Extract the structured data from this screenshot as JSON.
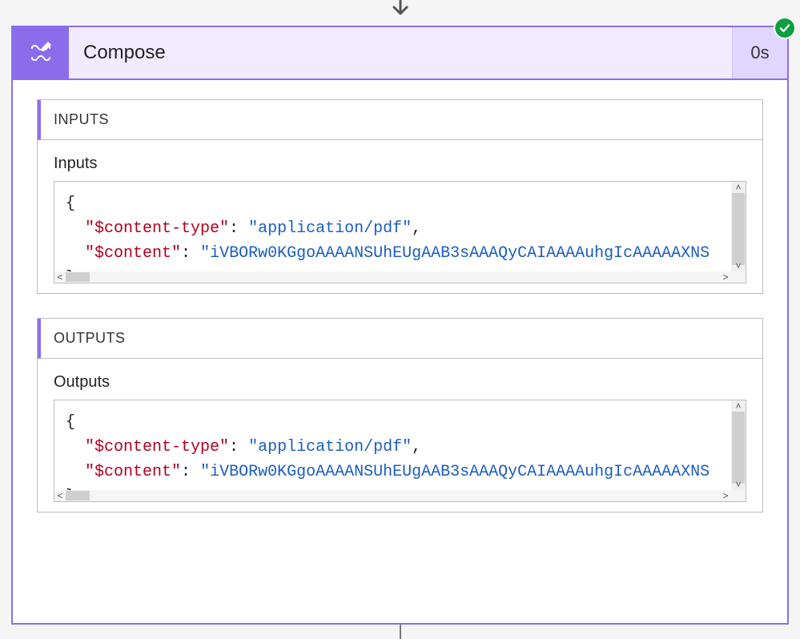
{
  "action": {
    "title": "Compose",
    "duration": "0s",
    "status": "success"
  },
  "panels": {
    "inputs": {
      "header": "INPUTS",
      "label": "Inputs",
      "json": {
        "open": "{",
        "close": "}",
        "lines": [
          {
            "key": "\"$content-type\"",
            "colon": ": ",
            "value": "\"application/pdf\"",
            "trail": ","
          },
          {
            "key": "\"$content\"",
            "colon": ": ",
            "value": "\"iVBORw0KGgoAAAANSUhEUgAAB3sAAAQyCAIAAAAuhgIcAAAAAXNS",
            "trail": ""
          }
        ]
      }
    },
    "outputs": {
      "header": "OUTPUTS",
      "label": "Outputs",
      "json": {
        "open": "{",
        "close": "}",
        "lines": [
          {
            "key": "\"$content-type\"",
            "colon": ": ",
            "value": "\"application/pdf\"",
            "trail": ","
          },
          {
            "key": "\"$content\"",
            "colon": ": ",
            "value": "\"iVBORw0KGgoAAAANSUhEUgAAB3sAAAQyCAIAAAAuhgIcAAAAAXNS",
            "trail": ""
          }
        ]
      }
    }
  }
}
